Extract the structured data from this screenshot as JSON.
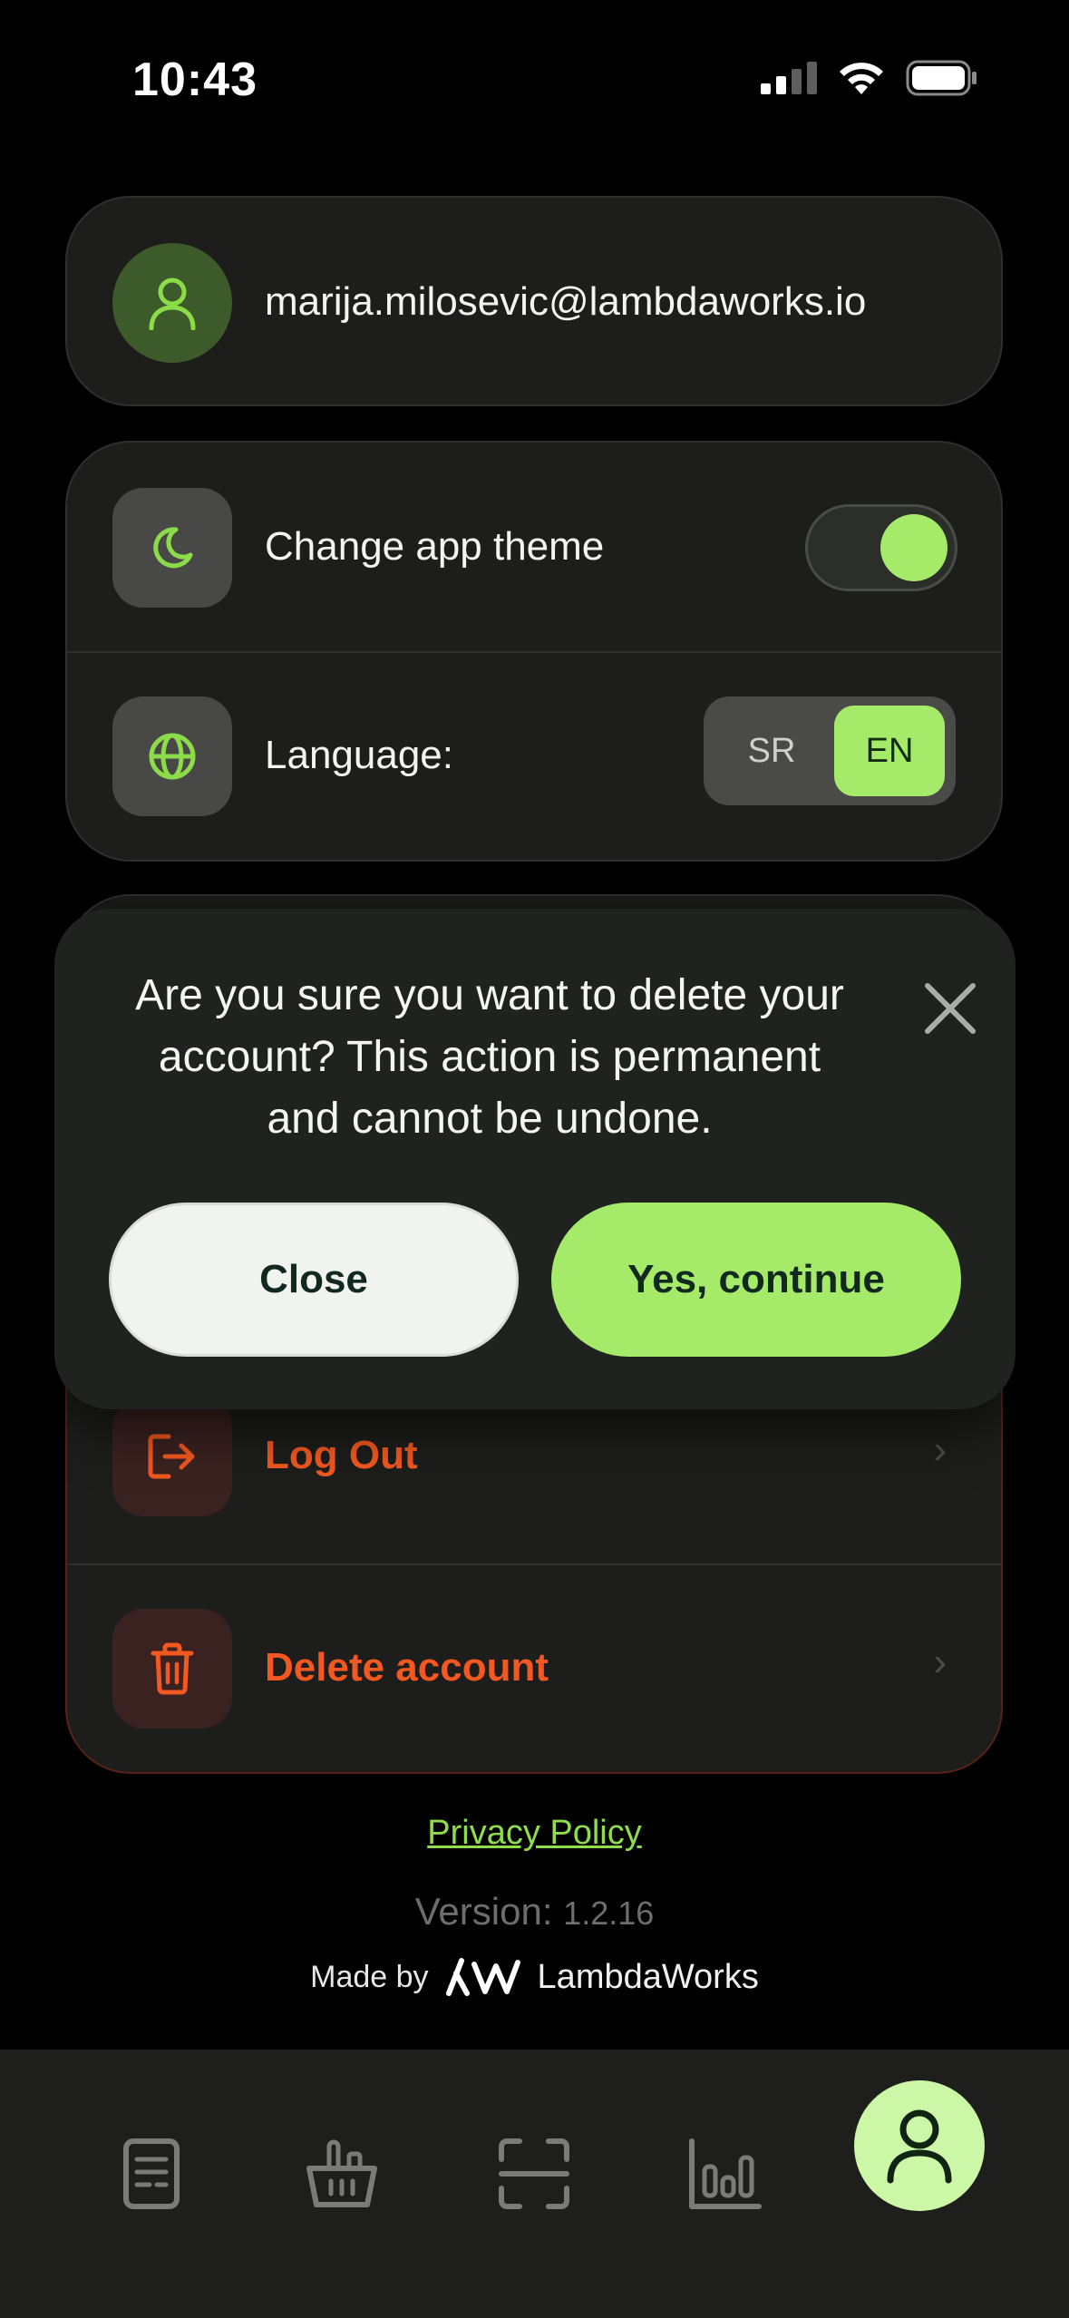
{
  "status_bar": {
    "time": "10:43"
  },
  "account": {
    "email": "marija.milosevic@lambdaworks.io"
  },
  "settings": {
    "theme_label": "Change app theme",
    "theme_on": true,
    "language_label": "Language:",
    "language_options": [
      "SR",
      "EN"
    ],
    "language_selected": "EN"
  },
  "actions": {
    "logout_label": "Log Out",
    "delete_label": "Delete account"
  },
  "modal": {
    "message": "Are you sure you want to delete your account? This action is permanent and cannot be undone.",
    "close_label": "Close",
    "confirm_label": "Yes, continue"
  },
  "footer": {
    "privacy_label": "Privacy Policy",
    "version_label": "Version:",
    "version_number": "1.2.16",
    "made_by": "Made by",
    "brand": "LambdaWorks"
  },
  "tabs": [
    {
      "icon": "receipt-icon"
    },
    {
      "icon": "basket-icon"
    },
    {
      "icon": "scan-icon"
    },
    {
      "icon": "stats-icon"
    },
    {
      "icon": "profile-icon",
      "active": true
    }
  ],
  "colors": {
    "accent": "#a6ea69",
    "danger": "#f2581f",
    "background": "#000000",
    "card": "#1d1e1b"
  }
}
